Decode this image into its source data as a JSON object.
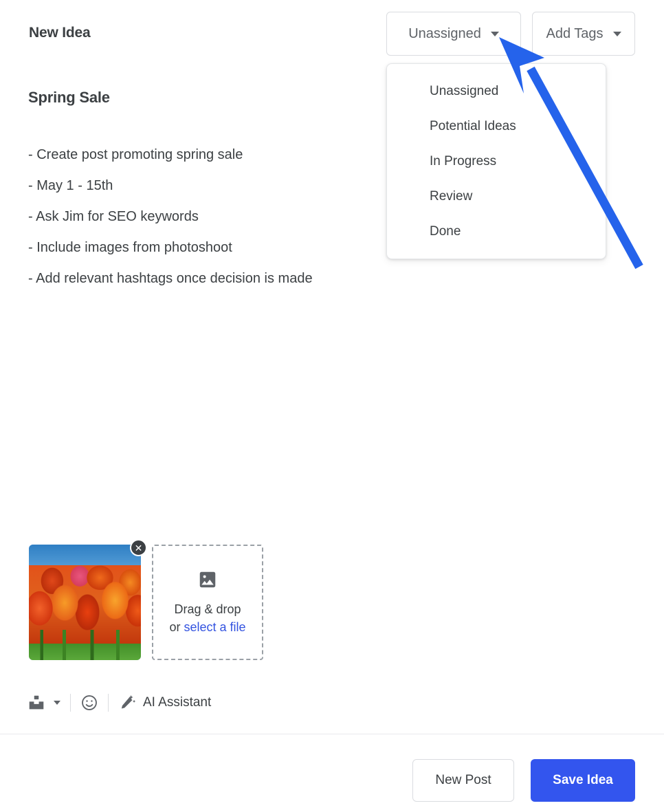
{
  "header": {
    "panel_title": "New Idea",
    "status_select": {
      "label": "Unassigned",
      "icon": "chevron-down-icon"
    },
    "tags_select": {
      "label": "Add Tags",
      "icon": "chevron-down-icon"
    }
  },
  "status_dropdown": {
    "open": true,
    "items": [
      {
        "label": "Unassigned"
      },
      {
        "label": "Potential Ideas"
      },
      {
        "label": "In Progress"
      },
      {
        "label": "Review"
      },
      {
        "label": "Done"
      }
    ]
  },
  "editor": {
    "doc_title": "Spring Sale",
    "lines": [
      "- Create post promoting spring sale",
      "- May 1 - 15th",
      "- Ask Jim for SEO keywords",
      "- Include images from photoshoot",
      "- Add relevant hashtags once decision is made"
    ]
  },
  "attachments": {
    "thumbnail": {
      "alt": "orange tulips photo",
      "remove_glyph": "✕"
    },
    "dropzone": {
      "icon": "image-icon",
      "text_prefix": "Drag & drop",
      "text_or": "or ",
      "link_text": "select a file"
    }
  },
  "toolbar": {
    "insert_media": {
      "icon": "insert-media-icon"
    },
    "insert_media_caret": {
      "icon": "chevron-down-icon"
    },
    "emoji": {
      "icon": "emoji-icon"
    },
    "ai_assistant": {
      "icon": "magic-wand-icon",
      "label": "AI Assistant"
    }
  },
  "footer": {
    "new_post_label": "New Post",
    "save_idea_label": "Save Idea"
  },
  "colors": {
    "primary": "#3355ee",
    "link": "#3353e0",
    "text": "#3c4043",
    "muted": "#5f6368",
    "border": "#dadce0",
    "annotation_arrow": "#2563eb"
  }
}
